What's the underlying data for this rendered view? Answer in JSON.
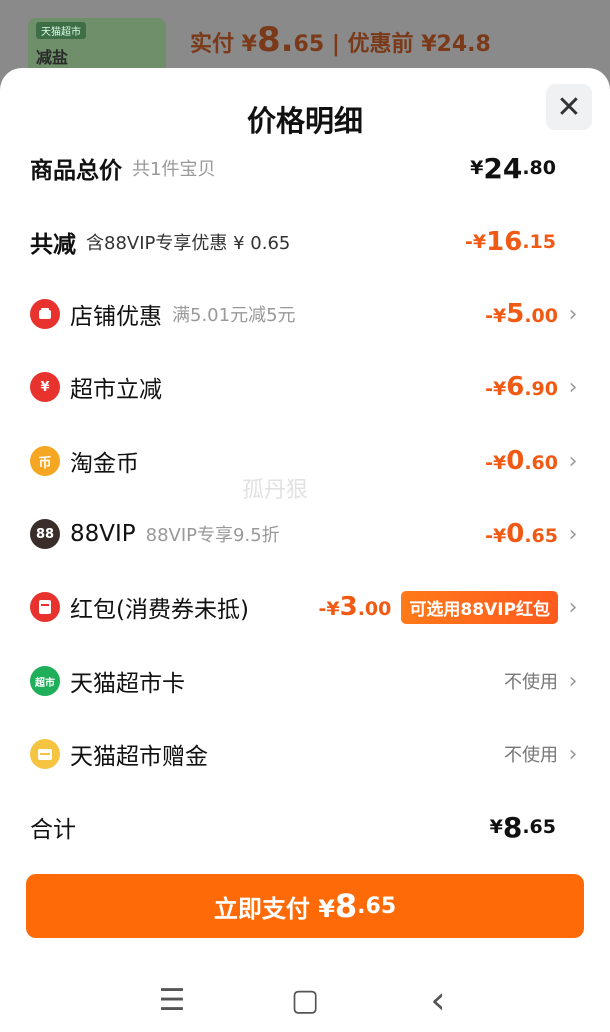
{
  "background": {
    "thumb_tag": "天猫超市",
    "thumb_text": "减盐",
    "actual_prefix": "实付 ¥",
    "actual_int": "8.",
    "actual_dec": "65",
    "before_text": "| 优惠前 ¥24.8"
  },
  "sheet": {
    "title": "价格明细",
    "close_symbol": "✕"
  },
  "rows": {
    "total_goods": {
      "label": "商品总价",
      "sub": "共1件宝贝",
      "yen": "¥",
      "int": "24",
      "dec": ".80"
    },
    "total_reduce": {
      "label": "共减",
      "sub": "含88VIP专享优惠 ¥ 0.65",
      "prefix": "-¥",
      "int": "16",
      "dec": ".15"
    },
    "shop_discount": {
      "label": "店铺优惠",
      "sub": "满5.01元减5元",
      "prefix": "-¥",
      "int": "5",
      "dec": ".00",
      "icon": "shop-icon",
      "color": "#e8322e"
    },
    "market_reduce": {
      "label": "超市立减",
      "prefix": "-¥",
      "int": "6",
      "dec": ".90",
      "icon": "yen-coupon-icon",
      "color": "#e8322e"
    },
    "gold_coin": {
      "label": "淘金币",
      "prefix": "-¥",
      "int": "0",
      "dec": ".60",
      "icon": "gold-coin-icon",
      "color": "#f5a623"
    },
    "vip88": {
      "label": "88VIP",
      "sub": "88VIP专享9.5折",
      "prefix": "-¥",
      "int": "0",
      "dec": ".65",
      "icon_text": "88",
      "color": "#3a2e2a"
    },
    "red_packet": {
      "label": "红包(消费券未抵)",
      "prefix": "-¥",
      "int": "3",
      "dec": ".00",
      "pill": "可选用88VIP红包",
      "icon": "red-packet-icon",
      "color": "#e8322e"
    },
    "market_card": {
      "label": "天猫超市卡",
      "status": "不使用",
      "icon_text": "超市",
      "color": "#1fae5a"
    },
    "market_gift": {
      "label": "天猫超市赠金",
      "status": "不使用",
      "icon": "gift-icon",
      "color": "#f5c542"
    },
    "sum": {
      "label": "合计",
      "yen": "¥",
      "int": "8",
      "dec": ".65"
    }
  },
  "pay_button": {
    "label": "立即支付 ¥",
    "int": "8",
    "dec": ".65"
  },
  "watermark": "孤丹狠",
  "nav": {
    "menu": "☰",
    "home": "▢",
    "back": "‹"
  }
}
